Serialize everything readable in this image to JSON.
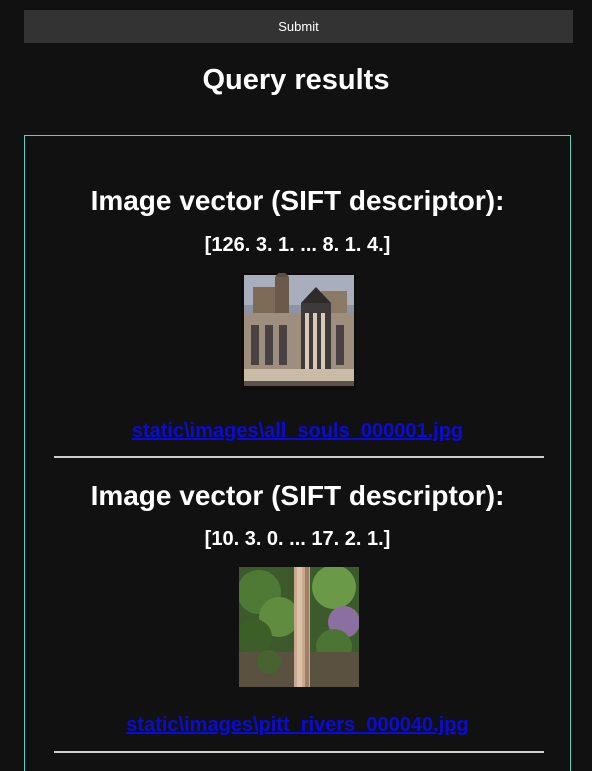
{
  "form": {
    "submit_label": "Submit"
  },
  "results_title": "Query results",
  "results": [
    {
      "heading": "Image vector (SIFT descriptor):",
      "vector": "[126. 3. 1. ... 8. 1. 4.]",
      "image_subject": "gothic college building (All Souls)",
      "link": "static\\images\\all_souls_000001.jpg"
    },
    {
      "heading": "Image vector (SIFT descriptor):",
      "vector": "[10. 3. 0. ... 17. 2. 1.]",
      "image_subject": "tree trunk with green foliage",
      "link": "static\\images\\pitt_rivers_000040.jpg"
    }
  ],
  "colors": {
    "background": "#111111",
    "box_border": "#5fcfc0",
    "link": "#0b0bd6",
    "button": "#333333"
  }
}
